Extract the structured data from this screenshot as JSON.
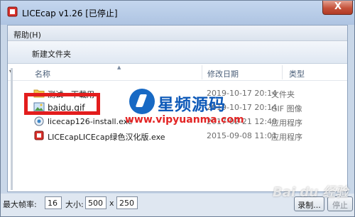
{
  "window": {
    "title": "LICEcap v1.26 [已停止]",
    "close_label": "X"
  },
  "menu": {
    "help": "帮助(H)"
  },
  "toolbar": {
    "new_folder": "新建文件夹"
  },
  "columns": {
    "name": "名称",
    "date": "修改日期",
    "type": "类型"
  },
  "files": [
    {
      "name": "测试 - 下载用",
      "date": "2019-10-17 20:14",
      "type": "文件夹",
      "icon": "folder-icon"
    },
    {
      "name": "baidu.gif",
      "date": "2019-10-17 20:14",
      "type": "GIF 图像",
      "icon": "gif-image-icon"
    },
    {
      "name": "licecap126-install.exe",
      "date": "2017-02-21 12:49",
      "type": "应用程序",
      "icon": "installer-icon"
    },
    {
      "name": "LICEcapLICEcap绿色汉化版.exe",
      "date": "2015-09-08 11:01",
      "type": "应用程序",
      "icon": "licecap-exe-icon"
    }
  ],
  "bottom": {
    "max_fps_label": "最大帧率:",
    "max_fps_value": "16",
    "size_label": "大小:",
    "width_value": "500",
    "x_label": "x",
    "height_value": "250",
    "record_button": "录制...",
    "stop_button": "停止"
  },
  "watermark": {
    "site_name": "星频源码",
    "site_url": "www.vipyuanma.com",
    "baidu_text": "Bai du 经验"
  },
  "colors": {
    "titlebar": "#b7cbe7",
    "highlight_border": "#e31d1d",
    "watermark_blue": "#0d59b8",
    "watermark_red": "#e32525"
  }
}
